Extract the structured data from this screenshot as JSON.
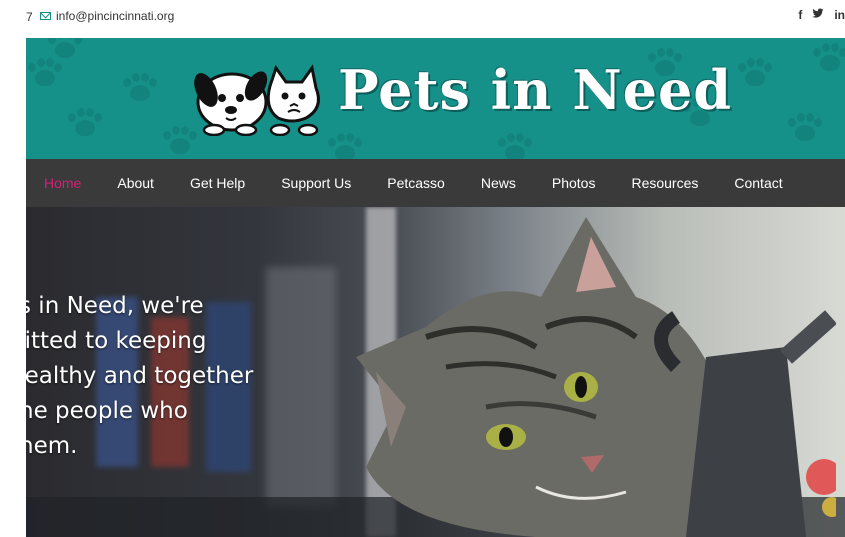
{
  "topbar": {
    "phone_fragment": "7",
    "email": "info@pincincinnati.org",
    "social": [
      "f",
      "✔",
      "in"
    ]
  },
  "header": {
    "logo_text": "Pets in Need",
    "brand_color": "#16918a"
  },
  "nav": {
    "items": [
      "Home",
      "About",
      "Get Help",
      "Support Us",
      "Petcasso",
      "News",
      "Photos",
      "Resources",
      "Contact"
    ],
    "active_index": 0,
    "active_color": "#d61f7a"
  },
  "hero": {
    "lines": [
      "ts in Need, we're",
      "nitted to keeping",
      "healthy and together",
      "the people who",
      "them."
    ],
    "image_subject": "tabby-cat-photo"
  }
}
